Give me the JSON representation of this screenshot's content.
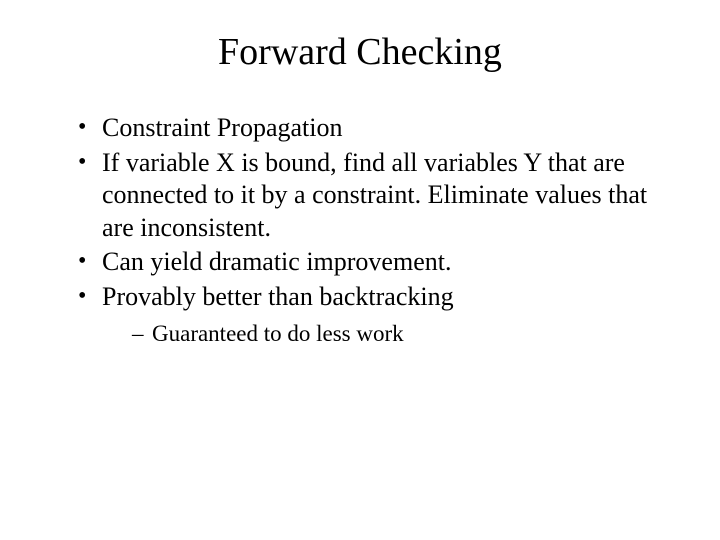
{
  "title": "Forward Checking",
  "bullets": [
    "Constraint Propagation",
    "If variable  X is bound, find all variables Y that are connected to it by a constraint. Eliminate values that are inconsistent.",
    "Can yield dramatic improvement.",
    "Provably better than backtracking"
  ],
  "subbullets": [
    "Guaranteed to do less work"
  ]
}
